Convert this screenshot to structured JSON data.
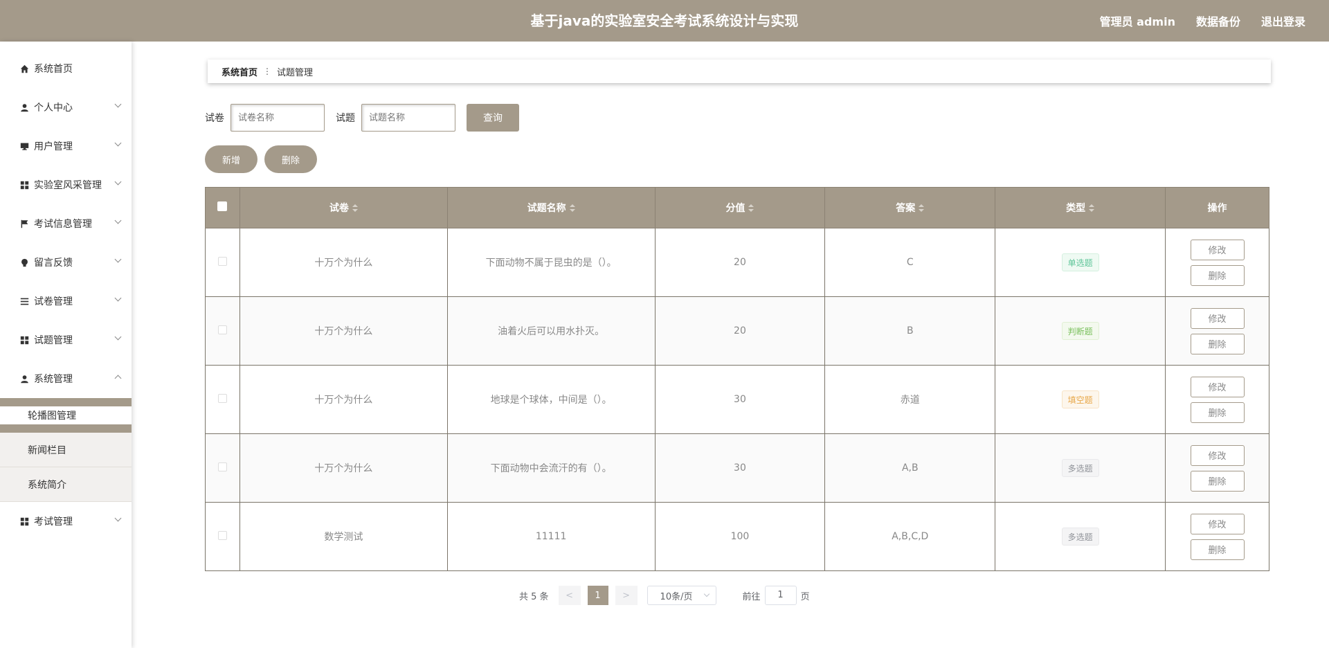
{
  "header": {
    "title": "基于java的实验室安全考试系统设计与实现",
    "admin": "管理员 admin",
    "backup": "数据备份",
    "logout": "退出登录"
  },
  "colors": {
    "theme": "#a49a8a"
  },
  "sidebar": {
    "items": [
      {
        "label": "系统首页",
        "icon": "home-icon"
      },
      {
        "label": "个人中心",
        "icon": "user-icon"
      },
      {
        "label": "用户管理",
        "icon": "monitor-icon"
      },
      {
        "label": "实验室风采管理",
        "icon": "grid-icon"
      },
      {
        "label": "考试信息管理",
        "icon": "flag-icon"
      },
      {
        "label": "留言反馈",
        "icon": "bulb-icon"
      },
      {
        "label": "试卷管理",
        "icon": "list-icon"
      },
      {
        "label": "试题管理",
        "icon": "grid-icon"
      },
      {
        "label": "系统管理",
        "icon": "user-icon"
      },
      {
        "label": "考试管理",
        "icon": "grid-icon"
      }
    ],
    "sub_items": [
      "轮播图管理",
      "新闻栏目",
      "系统简介"
    ]
  },
  "breadcrumb": {
    "home": "系统首页",
    "current": "试题管理"
  },
  "search": {
    "paper_label": "试卷",
    "paper_placeholder": "试卷名称",
    "question_label": "试题",
    "question_placeholder": "试题名称",
    "query_button": "查询"
  },
  "actions": {
    "add": "新增",
    "delete": "删除"
  },
  "table": {
    "columns": [
      "试卷",
      "试题名称",
      "分值",
      "答案",
      "类型",
      "操作"
    ],
    "rows": [
      {
        "paper": "十万个为什么",
        "question": "下面动物不属于昆虫的是（）。",
        "score": "20",
        "answer": "C",
        "type": "单选题"
      },
      {
        "paper": "十万个为什么",
        "question": "油着火后可以用水扑灭。",
        "score": "20",
        "answer": "B",
        "type": "判断题"
      },
      {
        "paper": "十万个为什么",
        "question": "地球是个球体，中间是（）。",
        "score": "30",
        "answer": "赤道",
        "type": "填空题"
      },
      {
        "paper": "十万个为什么",
        "question": "下面动物中会流汗的有（）。",
        "score": "30",
        "answer": "A,B",
        "type": "多选题"
      },
      {
        "paper": "数学测试",
        "question": "11111",
        "score": "100",
        "answer": "A,B,C,D",
        "type": "多选题"
      }
    ],
    "edit_label": "修改",
    "delete_label": "删除"
  },
  "pagination": {
    "total": "共 5 条",
    "prev": "<",
    "current": "1",
    "next": ">",
    "page_size": "10条/页",
    "goto": "前往",
    "goto_value": "1",
    "page_unit": "页"
  }
}
